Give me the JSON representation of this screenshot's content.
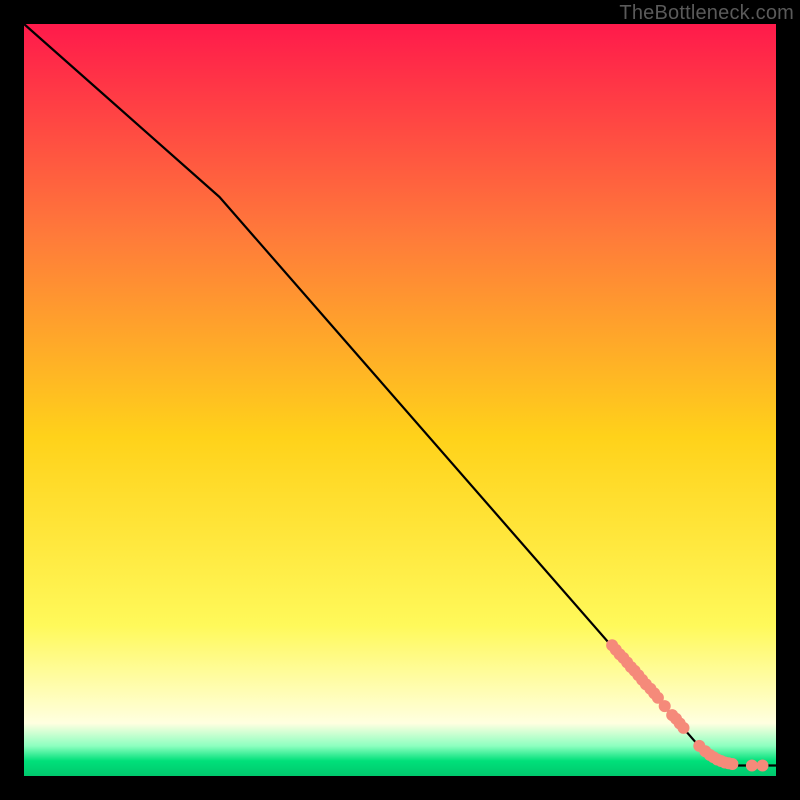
{
  "watermark": "TheBottleneck.com",
  "chart_data": {
    "type": "line",
    "title": "",
    "xlabel": "",
    "ylabel": "",
    "xlim": [
      0,
      100
    ],
    "ylim": [
      0,
      100
    ],
    "grid": false,
    "background_gradient": {
      "top": "#ff1a4b",
      "mid_upper": "#ff7a3a",
      "mid": "#ffd21a",
      "mid_lower": "#fff95a",
      "pale": "#ffffe0",
      "green": "#00e07a",
      "bottom_band_fraction": 0.045
    },
    "series": [
      {
        "name": "curve",
        "style": "line",
        "color": "#000000",
        "points_xy": [
          [
            0,
            100
          ],
          [
            26,
            77
          ],
          [
            90,
            3.7
          ],
          [
            92.5,
            2.0
          ],
          [
            95,
            1.4
          ],
          [
            100,
            1.4
          ]
        ]
      },
      {
        "name": "markers",
        "style": "scatter",
        "color": "#f58a7a",
        "radius_px": 6,
        "points_xy": [
          [
            78.2,
            17.4
          ],
          [
            78.7,
            16.8
          ],
          [
            79.2,
            16.2
          ],
          [
            79.7,
            15.7
          ],
          [
            80.2,
            15.1
          ],
          [
            80.7,
            14.5
          ],
          [
            81.2,
            14.0
          ],
          [
            81.7,
            13.4
          ],
          [
            82.2,
            12.8
          ],
          [
            82.7,
            12.2
          ],
          [
            83.3,
            11.6
          ],
          [
            83.8,
            11.0
          ],
          [
            84.3,
            10.4
          ],
          [
            85.2,
            9.3
          ],
          [
            86.2,
            8.1
          ],
          [
            86.7,
            7.6
          ],
          [
            87.2,
            7.0
          ],
          [
            87.7,
            6.4
          ],
          [
            89.8,
            4.0
          ],
          [
            90.6,
            3.3
          ],
          [
            91.2,
            2.8
          ],
          [
            91.7,
            2.5
          ],
          [
            92.2,
            2.2
          ],
          [
            92.7,
            2.0
          ],
          [
            93.2,
            1.8
          ],
          [
            93.7,
            1.7
          ],
          [
            94.2,
            1.6
          ],
          [
            96.8,
            1.4
          ],
          [
            98.2,
            1.4
          ]
        ]
      }
    ]
  }
}
